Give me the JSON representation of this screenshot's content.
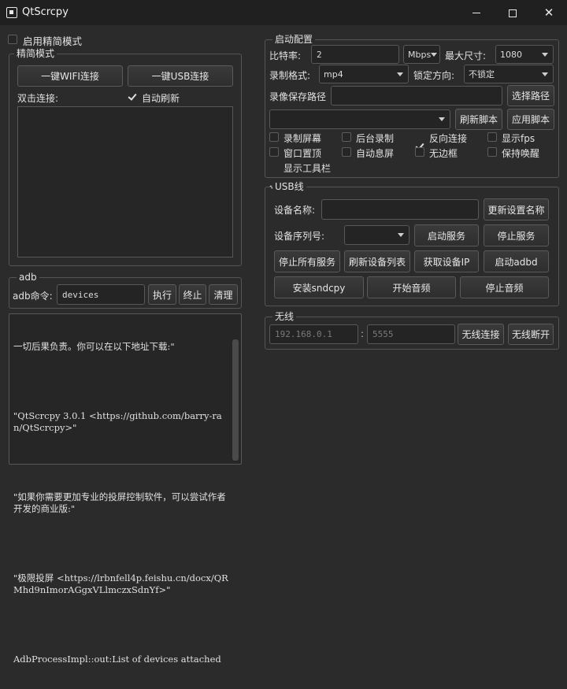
{
  "window": {
    "title": "QtScrcpy"
  },
  "simple_mode_toggle": {
    "label": "启用精简模式",
    "checked": false
  },
  "simple_mode": {
    "title": "精简模式",
    "wifi_button": "一键WIFI连接",
    "usb_button": "一键USB连接",
    "double_click_label": "双击连接:",
    "auto_refresh_label": "自动刷新",
    "auto_refresh_checked": true
  },
  "adb": {
    "title": "adb",
    "command_label": "adb命令:",
    "command_value": "devices",
    "execute_button": "执行",
    "terminate_button": "终止",
    "clear_button": "清理"
  },
  "log": {
    "lines": [
      "一切后果负责。你可以在以下地址下载:\"",
      "",
      "\"QtScrcpy 3.0.1 <https://github.com/barry-ran/QtScrcpy>\"",
      "",
      "\"如果你需要更加专业的投屏控制软件，可以尝试作者开发的商业版:\"",
      "",
      "\"极限投屏 <https://lrbnfell4p.feishu.cn/docx/QRMhd9nImorAGgxVLlmczxSdnYf>\"",
      "",
      "AdbProcessImpl::out:List of devices attached"
    ]
  },
  "launch_config": {
    "title": "启动配置",
    "bitrate_label": "比特率:",
    "bitrate_value": "2",
    "bitrate_unit": "Mbps",
    "max_size_label": "最大尺寸:",
    "max_size_value": "1080",
    "record_format_label": "录制格式:",
    "record_format_value": "mp4",
    "lock_orientation_label": "锁定方向:",
    "lock_orientation_value": "不锁定",
    "record_path_label": "录像保存路径",
    "record_path_value": "",
    "select_path_button": "选择路径",
    "script_value": "",
    "refresh_script_button": "刷新脚本",
    "apply_script_button": "应用脚本",
    "options": [
      {
        "label": "录制屏幕",
        "checked": false
      },
      {
        "label": "后台录制",
        "checked": false
      },
      {
        "label": "反向连接",
        "checked": true
      },
      {
        "label": "显示fps",
        "checked": false
      },
      {
        "label": "窗口置顶",
        "checked": false
      },
      {
        "label": "自动息屏",
        "checked": false
      },
      {
        "label": "无边框",
        "checked": false
      },
      {
        "label": "保持唤醒",
        "checked": false
      },
      {
        "label": "显示工具栏",
        "checked": true
      }
    ]
  },
  "usb": {
    "title": "USB线",
    "device_name_label": "设备名称:",
    "device_name_value": "",
    "update_name_button": "更新设置名称",
    "serial_label": "设备序列号:",
    "serial_value": "",
    "start_service_button": "启动服务",
    "stop_service_button": "停止服务",
    "stop_all_button": "停止所有服务",
    "refresh_devices_button": "刷新设备列表",
    "get_ip_button": "获取设备IP",
    "start_adbd_button": "启动adbd",
    "install_sndcpy_button": "安装sndcpy",
    "start_audio_button": "开始音频",
    "stop_audio_button": "停止音频"
  },
  "wireless": {
    "title": "无线",
    "ip_placeholder": "192.168.0.1",
    "separator": ":",
    "port_placeholder": "5555",
    "connect_button": "无线连接",
    "disconnect_button": "无线断开"
  }
}
